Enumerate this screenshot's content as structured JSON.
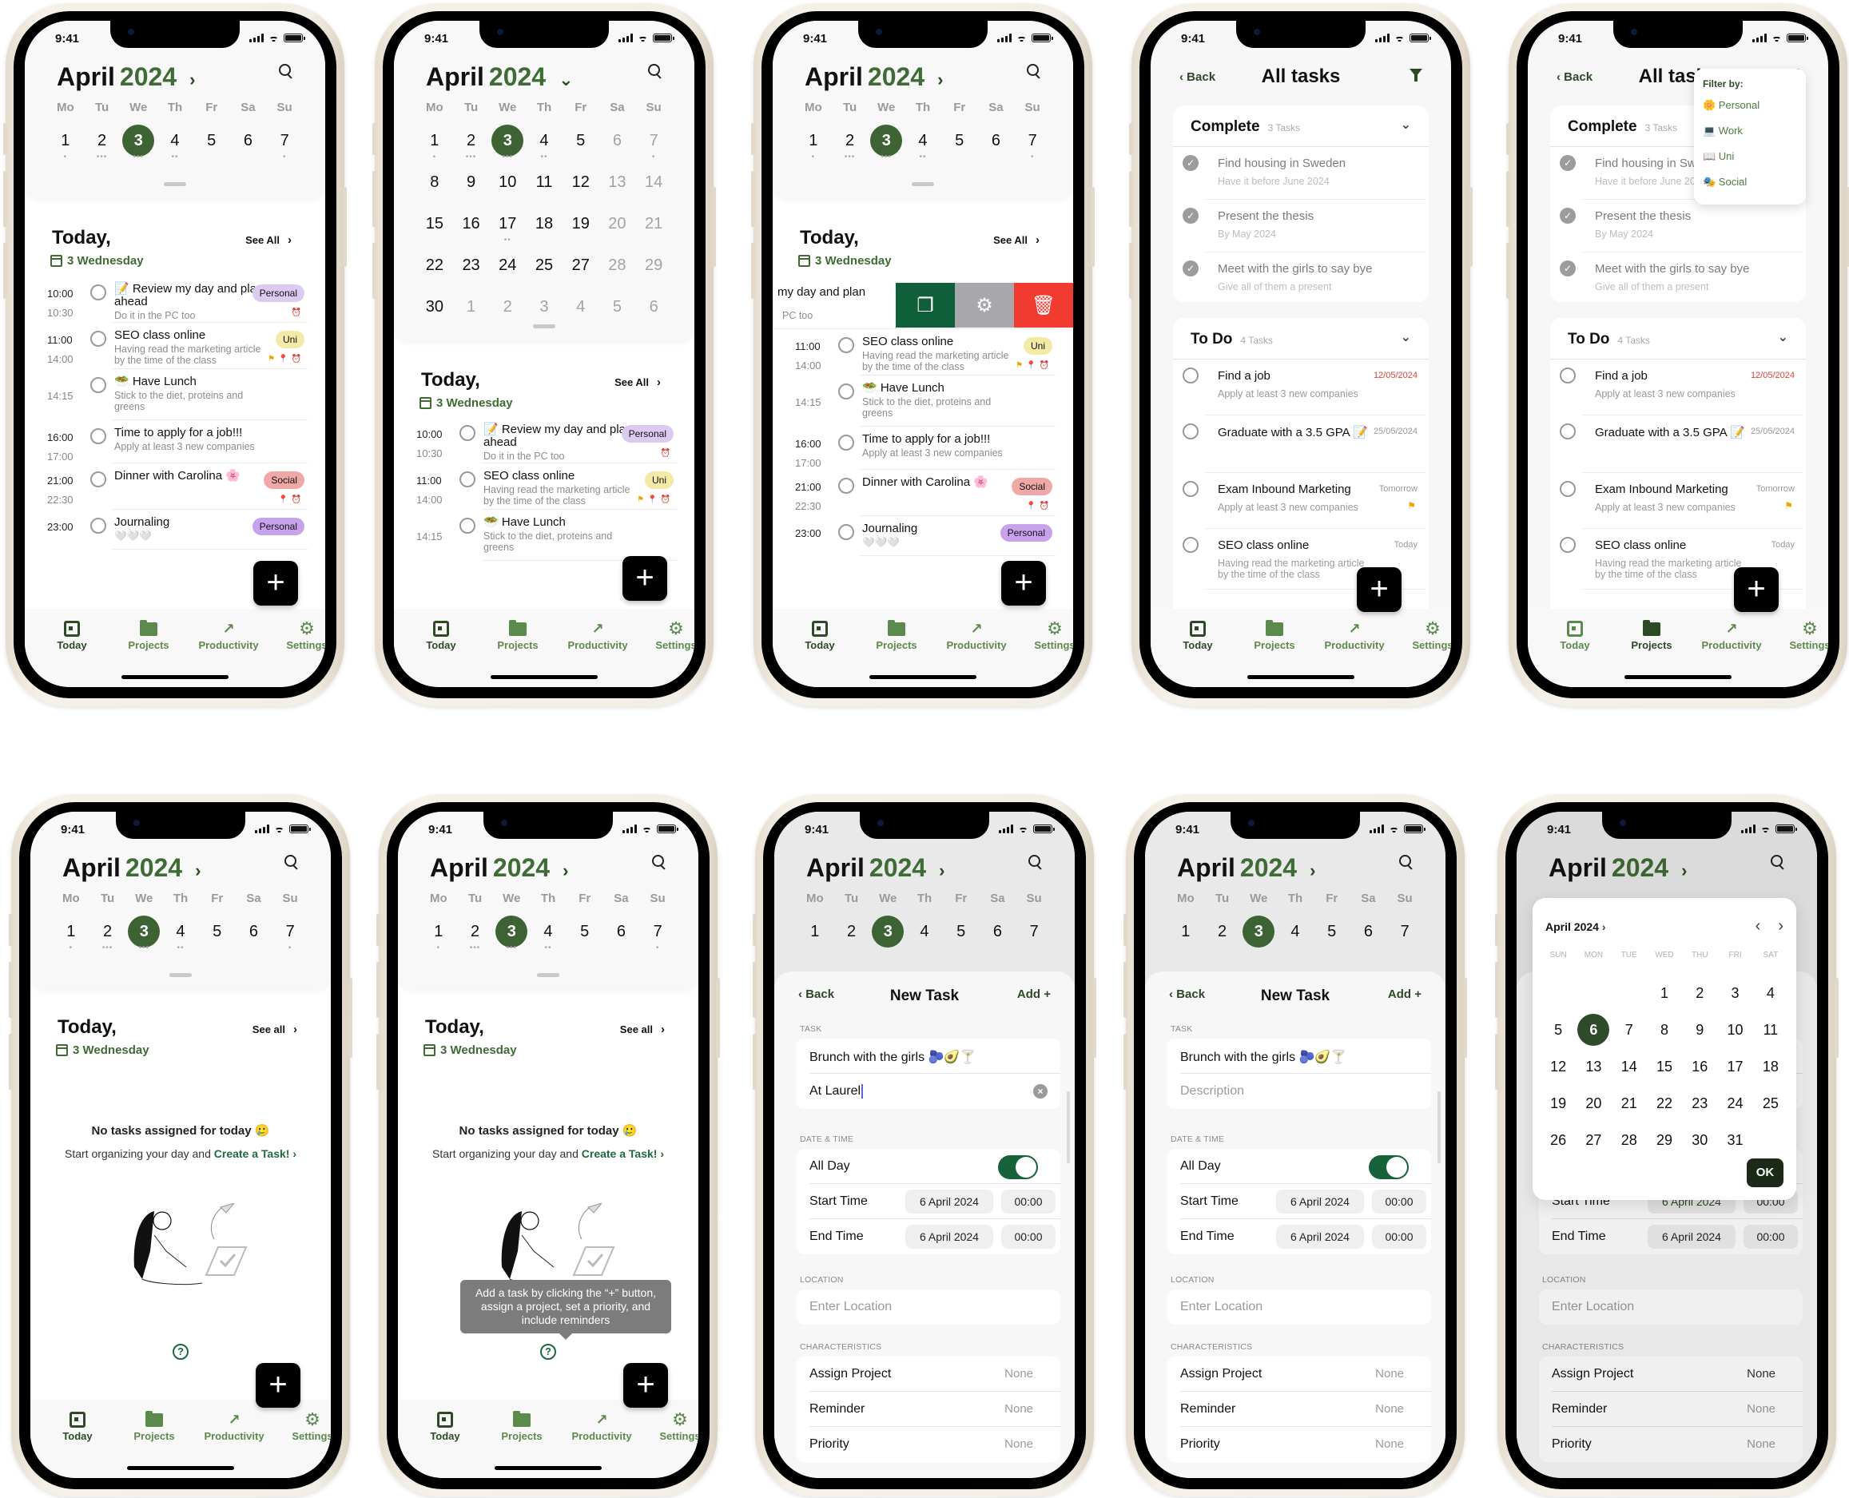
{
  "status": {
    "time": "9:41"
  },
  "calendar": {
    "month": "April",
    "year": "2024",
    "weekdays": [
      "Mo",
      "Tu",
      "We",
      "Th",
      "Fr",
      "Sa",
      "Su"
    ],
    "week": [
      {
        "d": "1",
        "dots": "•"
      },
      {
        "d": "2",
        "dots": "•••"
      },
      {
        "d": "3",
        "dots": "•••",
        "selected": true
      },
      {
        "d": "4",
        "dots": "••"
      },
      {
        "d": "5",
        "dots": ""
      },
      {
        "d": "6",
        "dots": ""
      },
      {
        "d": "7",
        "dots": "•"
      }
    ],
    "month_rows": [
      [
        {
          "d": "1",
          "dots": "•"
        },
        {
          "d": "2",
          "dots": "•••"
        },
        {
          "d": "3",
          "dots": "•••",
          "selected": true
        },
        {
          "d": "4",
          "dots": "••"
        },
        {
          "d": "5"
        },
        {
          "d": "6",
          "muted": true
        },
        {
          "d": "7",
          "muted": true,
          "dots": "•"
        }
      ],
      [
        {
          "d": "8"
        },
        {
          "d": "9"
        },
        {
          "d": "10"
        },
        {
          "d": "11"
        },
        {
          "d": "12"
        },
        {
          "d": "13",
          "muted": true
        },
        {
          "d": "14",
          "muted": true
        }
      ],
      [
        {
          "d": "15"
        },
        {
          "d": "16"
        },
        {
          "d": "17",
          "dots": "••"
        },
        {
          "d": "18"
        },
        {
          "d": "19"
        },
        {
          "d": "20",
          "muted": true
        },
        {
          "d": "21",
          "muted": true
        }
      ],
      [
        {
          "d": "22"
        },
        {
          "d": "23"
        },
        {
          "d": "24"
        },
        {
          "d": "25"
        },
        {
          "d": "27"
        },
        {
          "d": "28",
          "muted": true
        },
        {
          "d": "29",
          "muted": true
        }
      ],
      [
        {
          "d": "30"
        },
        {
          "d": "1",
          "muted": true
        },
        {
          "d": "2",
          "muted": true
        },
        {
          "d": "3",
          "muted": true
        },
        {
          "d": "4",
          "muted": true
        },
        {
          "d": "5",
          "muted": true
        },
        {
          "d": "6",
          "muted": true
        }
      ]
    ]
  },
  "today": {
    "heading": "Today,",
    "see_all": "See All",
    "see_all_lower": "See all",
    "date": "3 Wednesday"
  },
  "tasks": [
    {
      "start": "10:00",
      "end": "10:30",
      "title": "📝 Review my day and plan ahead",
      "desc": "Do it in the PC too",
      "tag": "Personal",
      "tag_color": "#dccbf0",
      "meta": [
        "alarm"
      ]
    },
    {
      "start": "11:00",
      "end": "14:00",
      "title": "SEO class online",
      "desc": "Having read the marketing article by the time of the class",
      "tag": "Uni",
      "tag_color": "#f2eaa6",
      "meta": [
        "flag",
        "pin",
        "alarm"
      ]
    },
    {
      "start": "",
      "end": "14:15",
      "title": "🥗 Have Lunch",
      "desc": "Stick to the diet, proteins and greens",
      "tag": "",
      "meta": []
    },
    {
      "start": "16:00",
      "end": "17:00",
      "title": "Time to apply for a job!!!",
      "desc": "Apply at least 3 new companies",
      "tag": "",
      "meta": []
    },
    {
      "start": "21:00",
      "end": "22:30",
      "title": "Dinner with Carolina 🌸",
      "desc": "",
      "tag": "Social",
      "tag_color": "#f0a8a6",
      "meta": [
        "pin",
        "alarm"
      ]
    },
    {
      "start": "23:00",
      "end": "",
      "title": "Journaling",
      "desc": "🤍🤍🤍",
      "tag": "Personal",
      "tag_color": "#c9a2ee",
      "meta": []
    }
  ],
  "swipe": {
    "partial_title": "my day and plan",
    "partial_desc": "PC too",
    "actions": [
      {
        "name": "duplicate",
        "icon": "❐",
        "color": "#0f5f3a"
      },
      {
        "name": "settings",
        "icon": "⚙",
        "color": "#a8a8ac"
      },
      {
        "name": "delete",
        "icon": "🗑",
        "color": "#f23b30"
      }
    ]
  },
  "tabbar": [
    {
      "label": "Today",
      "icon": "calendar"
    },
    {
      "label": "Projects",
      "icon": "folder"
    },
    {
      "label": "Productivity",
      "icon": "trend"
    },
    {
      "label": "Settings",
      "icon": "gear"
    }
  ],
  "all_tasks": {
    "back": "Back",
    "title": "All tasks",
    "complete": {
      "label": "Complete",
      "count": "3 Tasks",
      "items": [
        {
          "title": "Find housing in Sweden",
          "desc": "Have it before June 2024"
        },
        {
          "title": "Present the thesis",
          "desc": "By May 2024"
        },
        {
          "title": "Meet with the girls to say bye",
          "desc": "Give all of them a present"
        }
      ]
    },
    "todo": {
      "label": "To Do",
      "count": "4 Tasks",
      "items": [
        {
          "title": "Find a job",
          "desc": "Apply at least 3 new companies",
          "date": "12/05/2024",
          "overdue": true
        },
        {
          "title": "Graduate with a 3.5 GPA 📝",
          "desc": "",
          "date": "25/05/2024"
        },
        {
          "title": "Exam Inbound Marketing",
          "desc": "Apply at least 3 new companies",
          "date": "Tomorrow",
          "flag": true
        },
        {
          "title": "SEO class online",
          "desc": "Having read the marketing article by the time of the class",
          "date": "Today"
        }
      ]
    },
    "filter": {
      "heading": "Filter by:",
      "options": [
        "🌼 Personal",
        "💻 Work",
        "📖 Uni",
        "🎭 Social"
      ]
    }
  },
  "empty": {
    "title": "No tasks assigned for today 🥲",
    "subtitle": "Start organizing your day and",
    "link": "Create a Task!",
    "tooltip": "Add a task by clicking the “+” button, assign a project, set a priority, and include reminders"
  },
  "new_task": {
    "back": "Back",
    "title": "New Task",
    "add": "Add +",
    "task_label": "TASK",
    "task_title": "Brunch with the girls 🫐🥑🍸",
    "task_desc": "At Laurel",
    "desc_placeholder": "Description",
    "datetime_label": "DATE & TIME",
    "all_day": "All Day",
    "all_day_on": true,
    "start_label": "Start Time",
    "end_label": "End Time",
    "start_date": "6 April 2024",
    "end_date": "6 April 2024",
    "start_time": "00:00",
    "end_time": "00:00",
    "location_label": "LOCATION",
    "location_placeholder": "Enter Location",
    "char_label": "CHARACTERISTICS",
    "rows": [
      {
        "label": "Assign Project",
        "value": "None"
      },
      {
        "label": "Reminder",
        "value": "None"
      },
      {
        "label": "Priority",
        "value": "None"
      }
    ]
  },
  "date_picker": {
    "header": "April 2024",
    "weekdays": [
      "SUN",
      "MON",
      "TUE",
      "WED",
      "THU",
      "FRI",
      "SAT"
    ],
    "leading_blanks": 3,
    "days": 31,
    "selected": "6",
    "ok": "OK"
  },
  "colors": {
    "accent": "#3d6334",
    "accent_dark": "#2d4a27",
    "tab_inactive": "#5b8a4c"
  }
}
